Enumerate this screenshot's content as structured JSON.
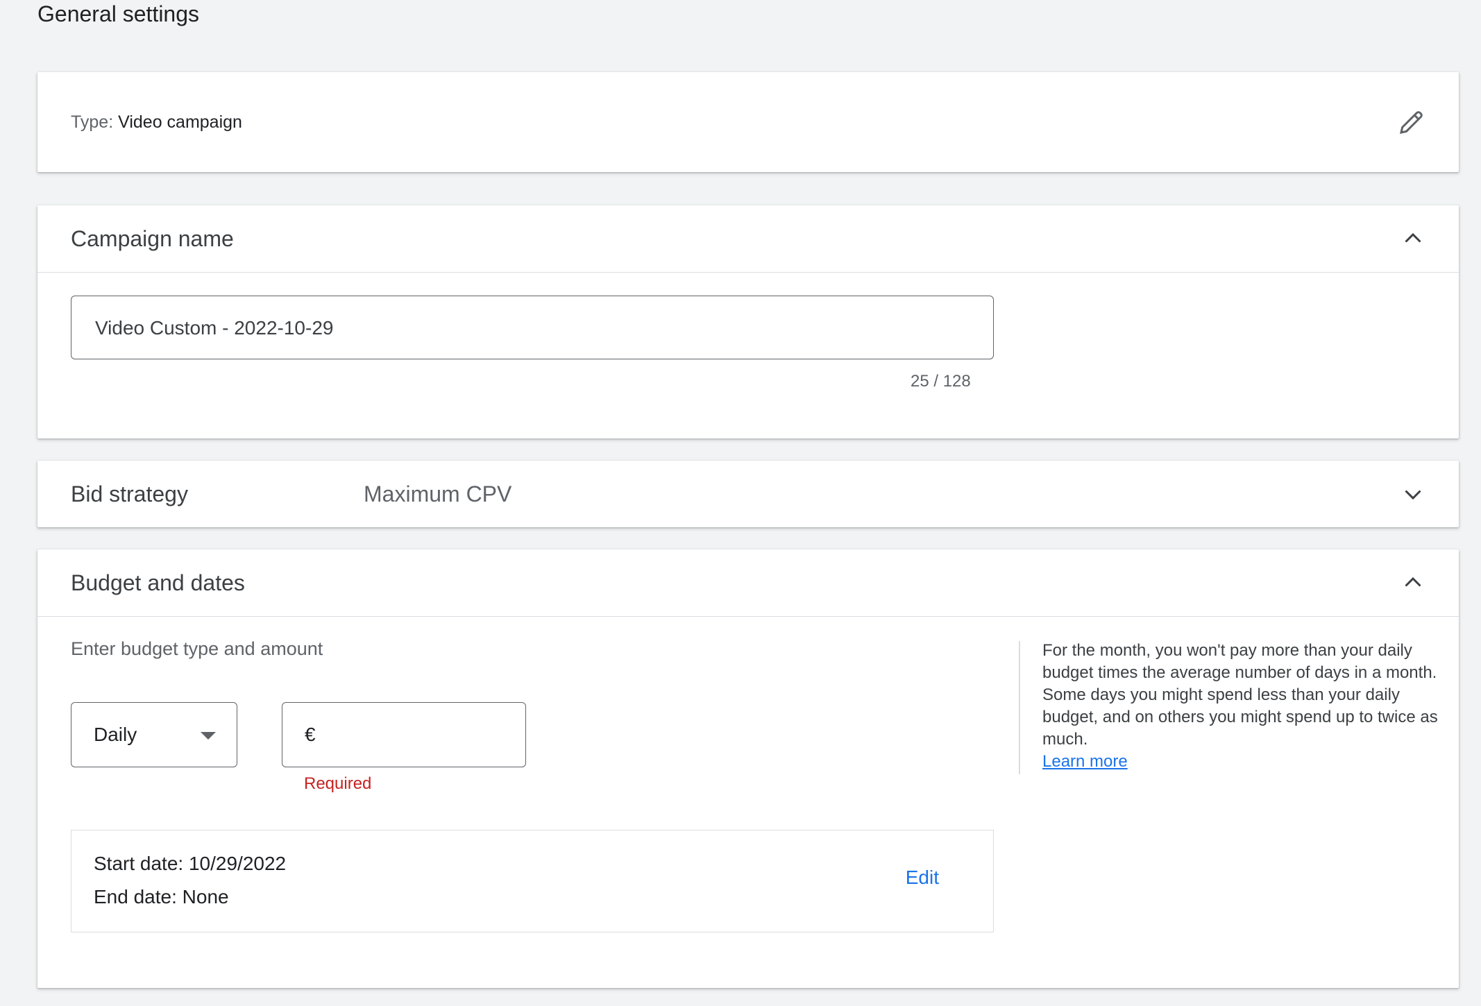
{
  "page": {
    "title": "General settings"
  },
  "type_card": {
    "label": "Type:",
    "value": "Video campaign"
  },
  "campaign_name": {
    "title": "Campaign name",
    "value": "Video Custom - 2022-10-29",
    "counter": "25 / 128"
  },
  "bid_strategy": {
    "title": "Bid strategy",
    "value": "Maximum CPV"
  },
  "budget": {
    "title": "Budget and dates",
    "sub_label": "Enter budget type and amount",
    "budget_type": "Daily",
    "currency": "€",
    "amount": "",
    "required": "Required",
    "help_text": "For the month, you won't pay more than your daily budget times the average number of days in a month. Some days you might spend less than your daily budget, and on others you might spend up to twice as much.",
    "learn_more": "Learn more",
    "start_date": "Start date: 10/29/2022",
    "end_date": "End date: None",
    "edit": "Edit"
  },
  "colors": {
    "accent": "#1a73e8",
    "error": "#c5221f",
    "background": "#f1f3f4"
  }
}
